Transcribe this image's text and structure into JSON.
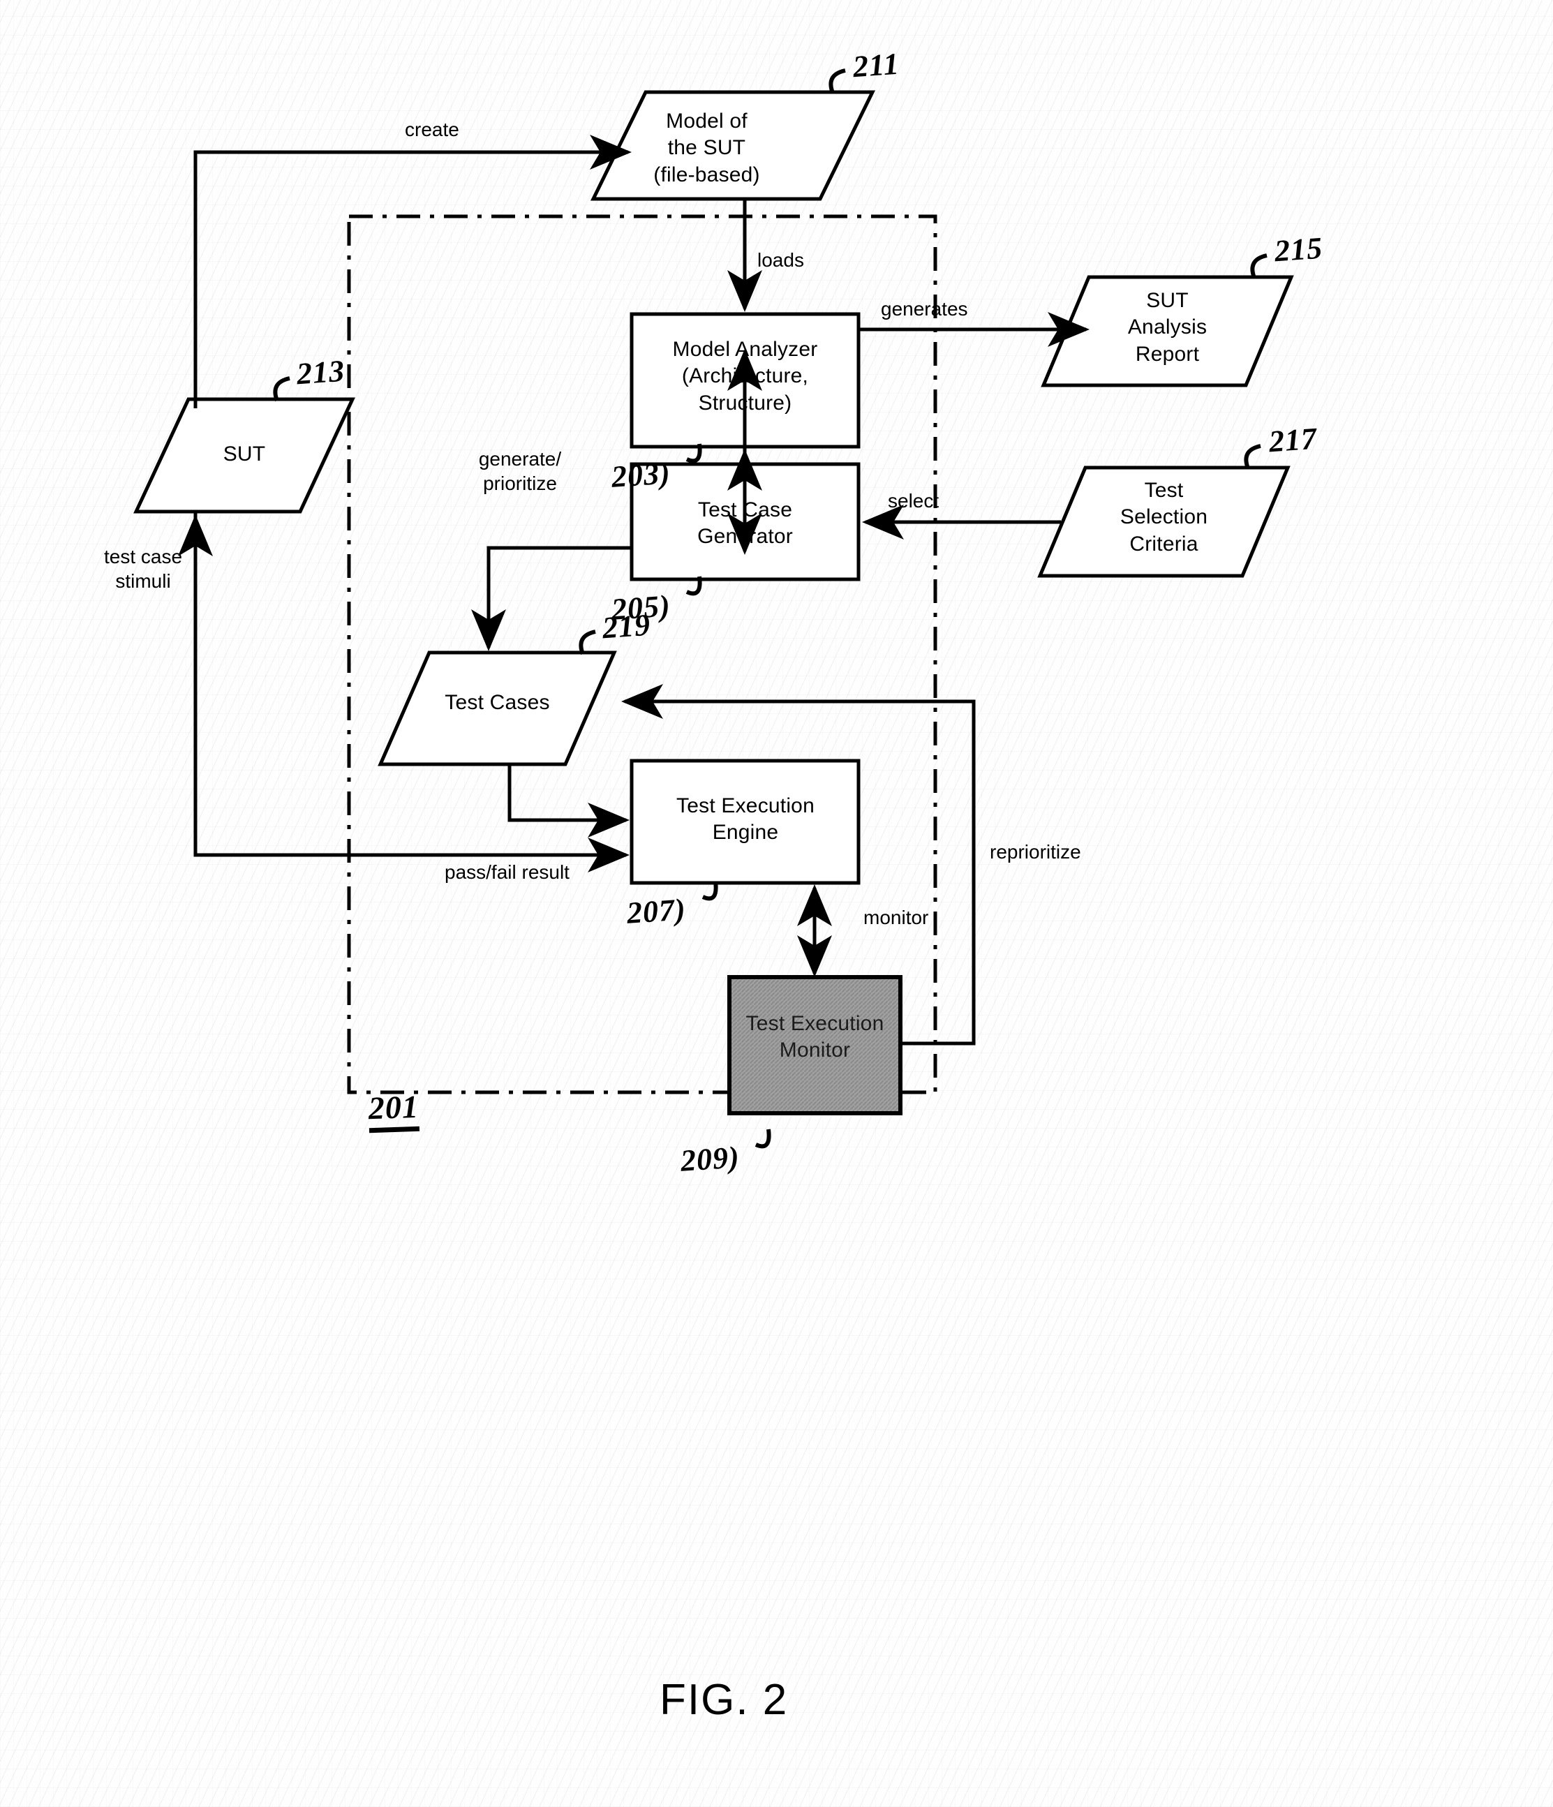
{
  "figure": {
    "caption": "FIG. 2",
    "system_ref": "201"
  },
  "nodes": [
    {
      "id": "model-of-sut",
      "shape": "parallelogram",
      "lines": [
        "Model of",
        "the SUT",
        "(file-based)"
      ],
      "ref": "211"
    },
    {
      "id": "sut",
      "shape": "parallelogram",
      "lines": [
        "SUT"
      ],
      "ref": "213"
    },
    {
      "id": "model-analyzer",
      "shape": "rectangle",
      "lines": [
        "Model Analyzer",
        "(Architecture,",
        "Structure)"
      ],
      "ref": "203)"
    },
    {
      "id": "sut-analysis-report",
      "shape": "parallelogram",
      "lines": [
        "SUT",
        "Analysis",
        "Report"
      ],
      "ref": "215"
    },
    {
      "id": "test-case-generator",
      "shape": "rectangle",
      "lines": [
        "Test Case",
        "Generator"
      ],
      "ref": "205)"
    },
    {
      "id": "test-selection-criteria",
      "shape": "parallelogram",
      "lines": [
        "Test",
        "Selection",
        "Criteria"
      ],
      "ref": "217"
    },
    {
      "id": "test-cases",
      "shape": "parallelogram",
      "lines": [
        "Test Cases"
      ],
      "ref": "219"
    },
    {
      "id": "test-execution-engine",
      "shape": "rectangle",
      "lines": [
        "Test Execution",
        "Engine"
      ],
      "ref": "207)"
    },
    {
      "id": "test-execution-monitor",
      "shape": "rectangle-shaded",
      "lines": [
        "Test Execution",
        "Monitor"
      ],
      "ref": "209)"
    }
  ],
  "edges": [
    {
      "id": "create",
      "label": "create",
      "from": "sut",
      "to": "model-of-sut"
    },
    {
      "id": "loads",
      "label": "loads",
      "from": "model-of-sut",
      "to": "model-analyzer"
    },
    {
      "id": "generates",
      "label": "generates",
      "from": "model-analyzer",
      "to": "sut-analysis-report"
    },
    {
      "id": "analyzer-generator",
      "label": "",
      "from": "model-analyzer",
      "to": "test-case-generator"
    },
    {
      "id": "select",
      "label": "select",
      "from": "test-selection-criteria",
      "to": "test-case-generator"
    },
    {
      "id": "generate-prioritize",
      "label": "generate/\nprioritize",
      "label_line1": "generate/",
      "label_line2": "prioritize",
      "from": "test-case-generator",
      "to": "test-cases"
    },
    {
      "id": "cases-to-engine",
      "label": "",
      "from": "test-cases",
      "to": "test-execution-engine"
    },
    {
      "id": "pass-fail",
      "label": "pass/fail result",
      "from": "sut",
      "to": "test-execution-engine"
    },
    {
      "id": "stimuli",
      "label": "test case\nstimuli",
      "label_line1": "test case",
      "label_line2": "stimuli",
      "from": "test-execution-engine",
      "to": "sut"
    },
    {
      "id": "monitor",
      "label": "monitor",
      "from": "test-execution-monitor",
      "to": "test-execution-engine"
    },
    {
      "id": "reprioritize",
      "label": "reprioritize",
      "from": "test-execution-monitor",
      "to": "test-cases"
    }
  ],
  "boundary": {
    "id": "system-boundary",
    "style": "dash-dot",
    "label": "201"
  },
  "colors": {
    "stroke": "#000000",
    "background": "#ffffff",
    "shaded_fill": "#9a9a9a"
  }
}
